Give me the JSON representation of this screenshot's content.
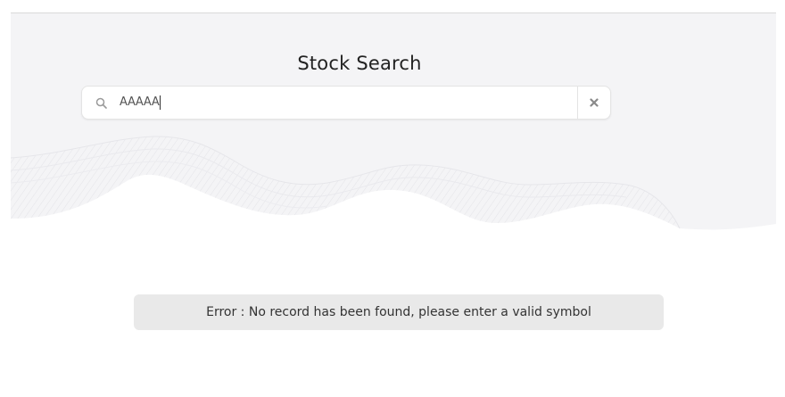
{
  "header": {
    "title": "Stock Search"
  },
  "search": {
    "value": "AAAAA",
    "icon": "search-icon",
    "clear_icon": "close-icon"
  },
  "error": {
    "message": "Error : No record has been found, please enter a valid symbol"
  },
  "colors": {
    "hero_background": "#f4f4f6",
    "error_background": "#e9e9e9",
    "text": "#222222"
  }
}
